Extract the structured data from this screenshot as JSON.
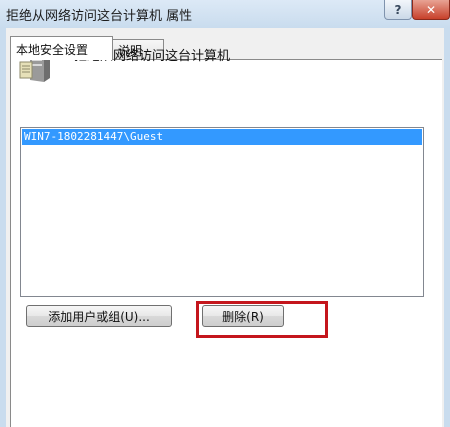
{
  "window": {
    "title": "拒绝从网络访问这台计算机 属性",
    "help_label": "?",
    "close_label": "✕"
  },
  "tabs": [
    {
      "label": "本地安全设置",
      "active": true
    },
    {
      "label": "说明",
      "active": false
    }
  ],
  "policy": {
    "icon": "server-icon",
    "title": "拒绝从网络访问这台计算机"
  },
  "accounts": [
    {
      "name": "WIN7-1802281447\\Guest",
      "selected": true
    }
  ],
  "buttons": {
    "add_label": "添加用户或组(U)...",
    "remove_label": "删除(R)"
  },
  "colors": {
    "selection": "#3399ff",
    "highlight_box": "#c4161c"
  }
}
